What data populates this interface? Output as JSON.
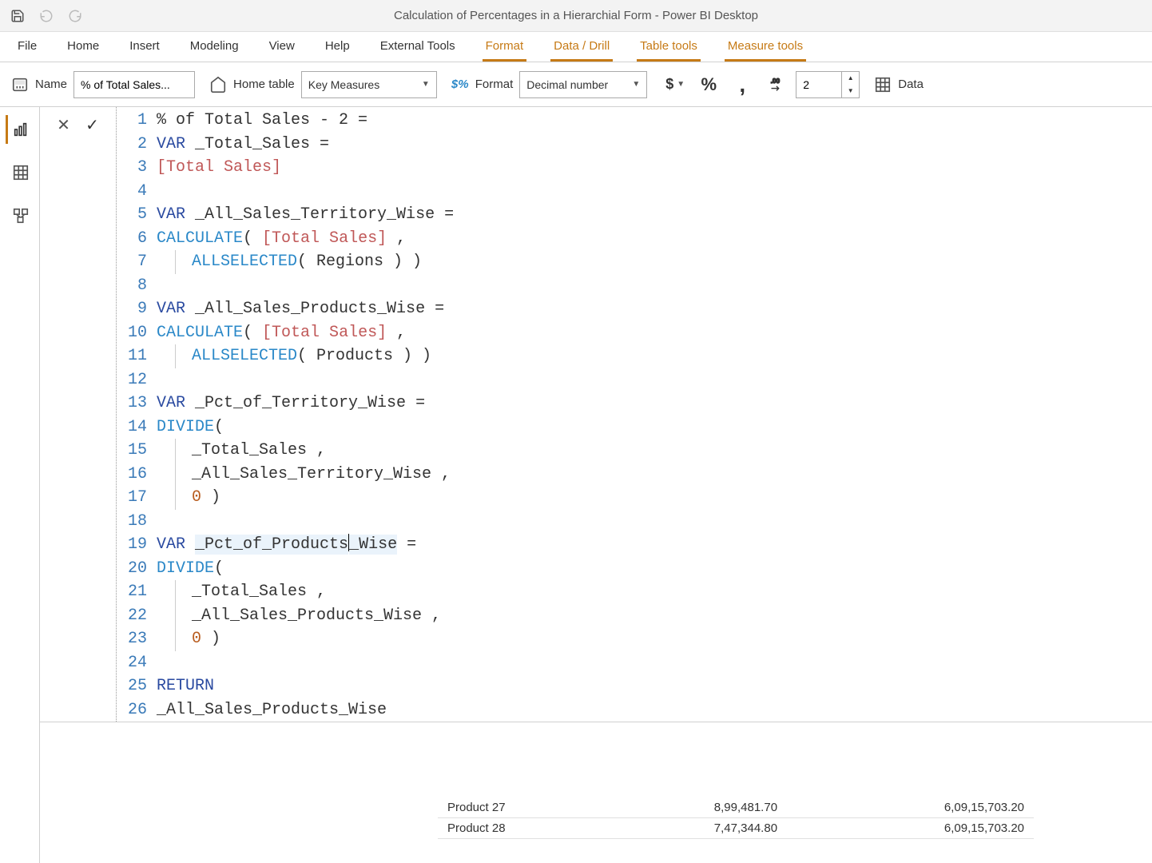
{
  "titlebar": {
    "title": "Calculation of Percentages in a Hierarchial Form - Power BI Desktop"
  },
  "ribbon": {
    "tabs": [
      "File",
      "Home",
      "Insert",
      "Modeling",
      "View",
      "Help",
      "External Tools",
      "Format",
      "Data / Drill",
      "Table tools",
      "Measure tools"
    ],
    "active_tabs": [
      "Format",
      "Data / Drill",
      "Table tools",
      "Measure tools"
    ],
    "name_label": "Name",
    "name_value": "% of Total Sales...",
    "hometable_label": "Home table",
    "hometable_value": "Key Measures",
    "format_label": "Format",
    "format_value": "Decimal number",
    "currency": "$",
    "percent": "%",
    "comma": ",",
    "decimals": "2",
    "datacat_label": "Data"
  },
  "code_lines": [
    [
      {
        "t": "text",
        "v": "% of Total Sales - 2 ="
      }
    ],
    [
      {
        "t": "kw",
        "v": "VAR"
      },
      {
        "t": "text",
        "v": " _Total_Sales ="
      }
    ],
    [
      {
        "t": "ref",
        "v": "[Total Sales]"
      }
    ],
    [],
    [
      {
        "t": "kw",
        "v": "VAR"
      },
      {
        "t": "text",
        "v": " _All_Sales_Territory_Wise ="
      }
    ],
    [
      {
        "t": "func",
        "v": "CALCULATE"
      },
      {
        "t": "text",
        "v": "( "
      },
      {
        "t": "ref",
        "v": "[Total Sales]"
      },
      {
        "t": "text",
        "v": " ,"
      }
    ],
    [
      {
        "indent": true
      },
      {
        "t": "func",
        "v": "ALLSELECTED"
      },
      {
        "t": "text",
        "v": "( Regions ) )"
      }
    ],
    [],
    [
      {
        "t": "kw",
        "v": "VAR"
      },
      {
        "t": "text",
        "v": " _All_Sales_Products_Wise ="
      }
    ],
    [
      {
        "t": "func",
        "v": "CALCULATE"
      },
      {
        "t": "text",
        "v": "( "
      },
      {
        "t": "ref",
        "v": "[Total Sales]"
      },
      {
        "t": "text",
        "v": " ,"
      }
    ],
    [
      {
        "indent": true
      },
      {
        "t": "func",
        "v": "ALLSELECTED"
      },
      {
        "t": "text",
        "v": "( Products ) )"
      }
    ],
    [],
    [
      {
        "t": "kw",
        "v": "VAR"
      },
      {
        "t": "text",
        "v": " _Pct_of_Territory_Wise ="
      }
    ],
    [
      {
        "t": "func",
        "v": "DIVIDE"
      },
      {
        "t": "text",
        "v": "("
      }
    ],
    [
      {
        "indent": true
      },
      {
        "t": "text",
        "v": "_Total_Sales ,"
      }
    ],
    [
      {
        "indent": true
      },
      {
        "t": "text",
        "v": "_All_Sales_Territory_Wise ,"
      }
    ],
    [
      {
        "indent": true
      },
      {
        "t": "num",
        "v": "0"
      },
      {
        "t": "text",
        "v": " )"
      }
    ],
    [],
    [
      {
        "t": "kw",
        "v": "VAR"
      },
      {
        "t": "text",
        "v": " "
      },
      {
        "t": "hl",
        "v": "_Pct_of_Products"
      },
      {
        "t": "caret",
        "v": ""
      },
      {
        "t": "hl",
        "v": "_Wise"
      },
      {
        "t": "text",
        "v": " ="
      }
    ],
    [
      {
        "t": "func",
        "v": "DIVIDE"
      },
      {
        "t": "text",
        "v": "("
      }
    ],
    [
      {
        "indent": true
      },
      {
        "t": "text",
        "v": "_Total_Sales ,"
      }
    ],
    [
      {
        "indent": true
      },
      {
        "t": "text",
        "v": "_All_Sales_Products_Wise ,"
      }
    ],
    [
      {
        "indent": true
      },
      {
        "t": "num",
        "v": "0"
      },
      {
        "t": "text",
        "v": " )"
      }
    ],
    [],
    [
      {
        "t": "kw",
        "v": "RETURN"
      }
    ],
    [
      {
        "t": "text",
        "v": "_All_Sales_Products_Wise"
      }
    ]
  ],
  "table": {
    "rows": [
      {
        "product": "Product 27",
        "sales": "8,99,481.70",
        "total": "6,09,15,703.20"
      },
      {
        "product": "Product 28",
        "sales": "7,47,344.80",
        "total": "6,09,15,703.20"
      }
    ]
  }
}
